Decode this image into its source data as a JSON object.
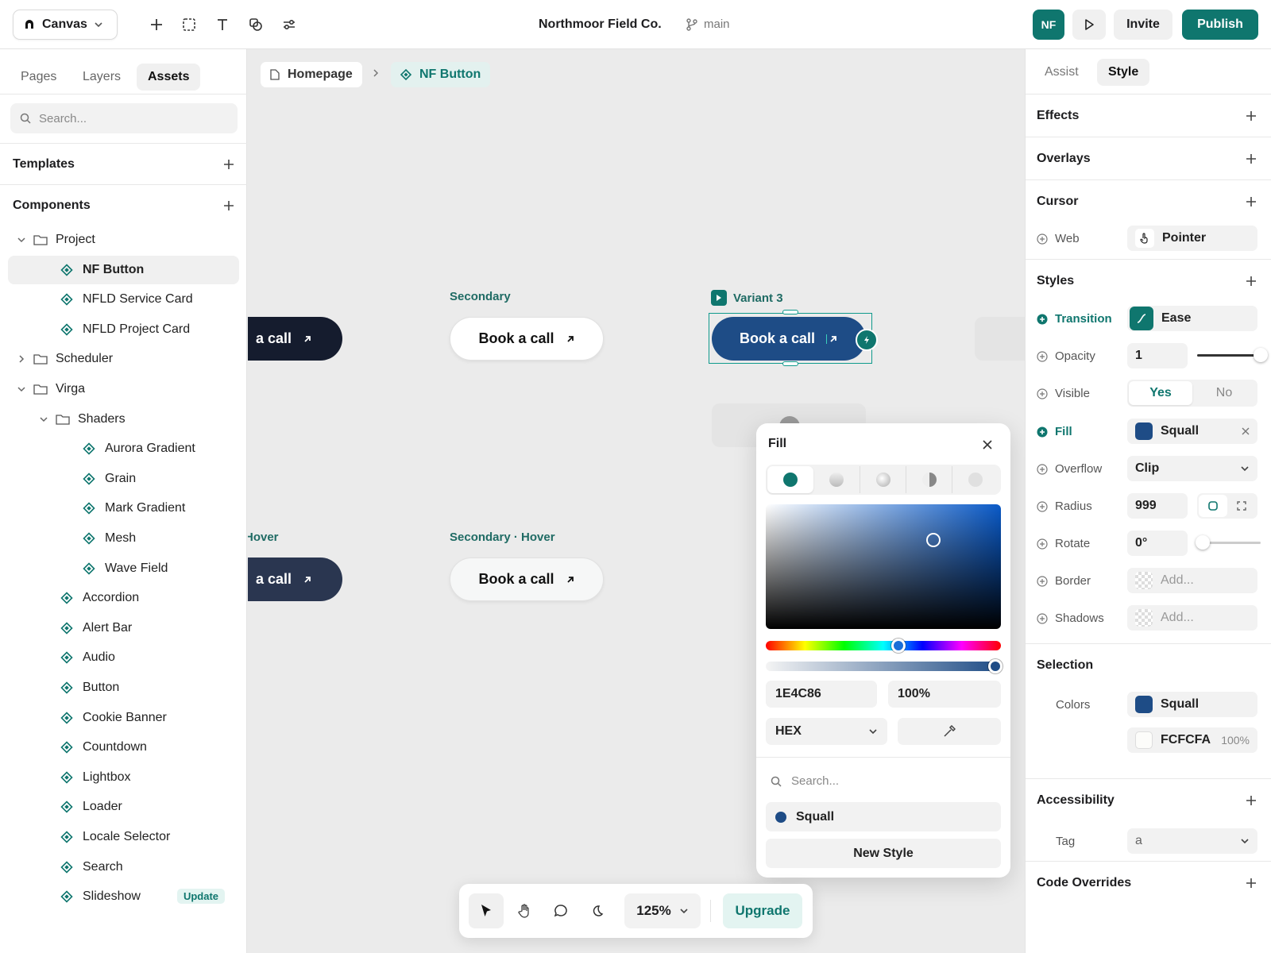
{
  "topbar": {
    "project_menu": "Canvas",
    "doc_title": "Northmoor Field Co.",
    "branch": "main",
    "avatar": "NF",
    "invite": "Invite",
    "publish": "Publish",
    "tools": [
      "plus-icon",
      "frame-icon",
      "text-icon",
      "shapes-icon",
      "settings-sliders-icon"
    ]
  },
  "left": {
    "tabs": [
      "Pages",
      "Layers",
      "Assets"
    ],
    "active_tab": "Assets",
    "search_placeholder": "Search...",
    "templates_label": "Templates",
    "components_label": "Components",
    "tree": [
      {
        "label": "Project",
        "kind": "folder",
        "depth": 0,
        "expanded": true
      },
      {
        "label": "NF Button",
        "kind": "component",
        "depth": 1,
        "selected": true
      },
      {
        "label": "NFLD Service Card",
        "kind": "component",
        "depth": 1
      },
      {
        "label": "NFLD Project Card",
        "kind": "component",
        "depth": 1
      },
      {
        "label": "Scheduler",
        "kind": "folder",
        "depth": 0,
        "expanded": false
      },
      {
        "label": "Virga",
        "kind": "folder",
        "depth": 0,
        "expanded": true
      },
      {
        "label": "Shaders",
        "kind": "folder",
        "depth": 1,
        "expanded": true
      },
      {
        "label": "Aurora Gradient",
        "kind": "component",
        "depth": 2
      },
      {
        "label": "Grain",
        "kind": "component",
        "depth": 2
      },
      {
        "label": "Mark Gradient",
        "kind": "component",
        "depth": 2
      },
      {
        "label": "Mesh",
        "kind": "component",
        "depth": 2
      },
      {
        "label": "Wave Field",
        "kind": "component",
        "depth": 2
      },
      {
        "label": "Accordion",
        "kind": "component",
        "depth": 1
      },
      {
        "label": "Alert Bar",
        "kind": "component",
        "depth": 1
      },
      {
        "label": "Audio",
        "kind": "component",
        "depth": 1
      },
      {
        "label": "Button",
        "kind": "component",
        "depth": 1
      },
      {
        "label": "Cookie Banner",
        "kind": "component",
        "depth": 1
      },
      {
        "label": "Countdown",
        "kind": "component",
        "depth": 1
      },
      {
        "label": "Lightbox",
        "kind": "component",
        "depth": 1
      },
      {
        "label": "Loader",
        "kind": "component",
        "depth": 1
      },
      {
        "label": "Locale Selector",
        "kind": "component",
        "depth": 1
      },
      {
        "label": "Search",
        "kind": "component",
        "depth": 1
      },
      {
        "label": "Slideshow",
        "kind": "component",
        "depth": 1,
        "badge": "Update"
      }
    ]
  },
  "canvas": {
    "breadcrumb": [
      "Homepage",
      "NF Button"
    ],
    "labels": {
      "secondary": "Secondary",
      "variant3": "Variant 3",
      "hover": "Hover",
      "secondary_hover": "Secondary · Hover"
    },
    "button_text": "Book a call",
    "partial_text": "a call"
  },
  "fill_popover": {
    "title": "Fill",
    "fill_types": [
      "solid",
      "linear",
      "radial",
      "conic",
      "image"
    ],
    "hex": "1E4C86",
    "opacity": "100%",
    "format": "HEX",
    "search_placeholder": "Search...",
    "styles": [
      {
        "name": "Squall",
        "color": "#1E4C86"
      }
    ],
    "new_style": "New Style"
  },
  "right": {
    "tabs": [
      "Assist",
      "Style"
    ],
    "active_tab": "Style",
    "sections": {
      "effects": "Effects",
      "overlays": "Overlays",
      "cursor": "Cursor",
      "styles": "Styles",
      "selection": "Selection",
      "accessibility": "Accessibility",
      "code_overrides": "Code Overrides"
    },
    "cursor": {
      "label": "Web",
      "value": "Pointer"
    },
    "transition": {
      "label": "Transition",
      "value": "Ease"
    },
    "opacity": {
      "label": "Opacity",
      "value": "1",
      "slider": 1.0
    },
    "visible": {
      "label": "Visible",
      "yes": "Yes",
      "no": "No",
      "selected": "Yes"
    },
    "fill": {
      "label": "Fill",
      "value": "Squall",
      "color": "#1E4C86"
    },
    "overflow": {
      "label": "Overflow",
      "value": "Clip"
    },
    "radius": {
      "label": "Radius",
      "value": "999"
    },
    "rotate": {
      "label": "Rotate",
      "value": "0°",
      "slider": 0.0
    },
    "border": {
      "label": "Border",
      "value": "Add..."
    },
    "shadows": {
      "label": "Shadows",
      "value": "Add..."
    },
    "selection_colors": {
      "label": "Colors",
      "items": [
        {
          "name": "Squall",
          "color": "#1E4C86"
        },
        {
          "name": "FCFCFA",
          "color": "#FCFCFA",
          "opacity": "100%"
        }
      ]
    },
    "tag": {
      "label": "Tag",
      "value": "a"
    }
  },
  "bottombar": {
    "zoom": "125%",
    "upgrade": "Upgrade"
  },
  "colors": {
    "accent": "#0f766e",
    "squall": "#1E4C86",
    "dark_button": "#151c2e"
  }
}
